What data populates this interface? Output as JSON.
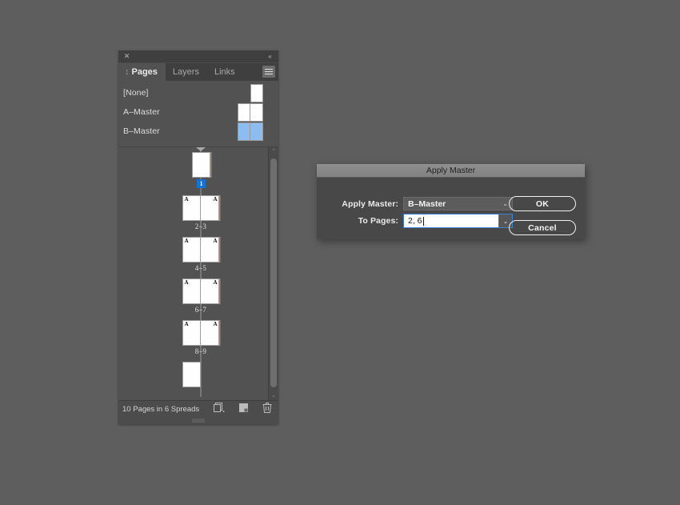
{
  "colors": {
    "app_background": "#5e5e5e",
    "panel_background": "#525252",
    "panel_header": "#3f3f3f",
    "dialog_background": "#484848",
    "dialog_titlebar": "#8a8a8a",
    "accent_blue": "#1473d6",
    "selection_blue": "#8cbcf0",
    "focus_border": "#3b82d6"
  },
  "pages_panel": {
    "titlebar": {
      "close_icon": "close-icon",
      "close_glyph": "✕",
      "collapse_icon": "collapse-panel-icon",
      "collapse_glyph": "«"
    },
    "tabs": [
      {
        "label": "Pages",
        "active": true
      },
      {
        "label": "Layers",
        "active": false
      },
      {
        "label": "Links",
        "active": false
      }
    ],
    "menu_icon": "panel-menu-icon",
    "masters": [
      {
        "name": "[None]",
        "pages": 1,
        "selected": false
      },
      {
        "name": "A–Master",
        "pages": 2,
        "selected": false
      },
      {
        "name": "B–Master",
        "pages": 2,
        "selected": true
      }
    ],
    "spreads": [
      {
        "label": "1",
        "type": "single-right",
        "badge": true,
        "masters": []
      },
      {
        "label": "2–3",
        "type": "spread",
        "masters": [
          "A",
          "A"
        ]
      },
      {
        "label": "4–5",
        "type": "spread",
        "masters": [
          "A",
          "A"
        ]
      },
      {
        "label": "6–7",
        "type": "spread",
        "masters": [
          "A",
          "A"
        ]
      },
      {
        "label": "8–9",
        "type": "spread",
        "masters": [
          "A",
          "A"
        ]
      },
      {
        "label": "",
        "type": "single-left",
        "masters": []
      }
    ],
    "status": {
      "text": "10 Pages in 6 Spreads",
      "icons": [
        "new-page-from-master-icon",
        "create-new-page-icon",
        "delete-page-icon"
      ]
    },
    "scrollbar": {
      "up_arrow_glyph": "⌃",
      "down_arrow_glyph": "⌄"
    }
  },
  "dialog": {
    "title": "Apply Master",
    "fields": {
      "apply_master": {
        "label": "Apply Master:",
        "value": "B–Master",
        "chevron_glyph": "⌄"
      },
      "to_pages": {
        "label": "To Pages:",
        "value": "2, 6",
        "placeholder": "",
        "chevron_glyph": "⌄",
        "focused": true
      }
    },
    "buttons": {
      "ok": "OK",
      "cancel": "Cancel"
    }
  }
}
